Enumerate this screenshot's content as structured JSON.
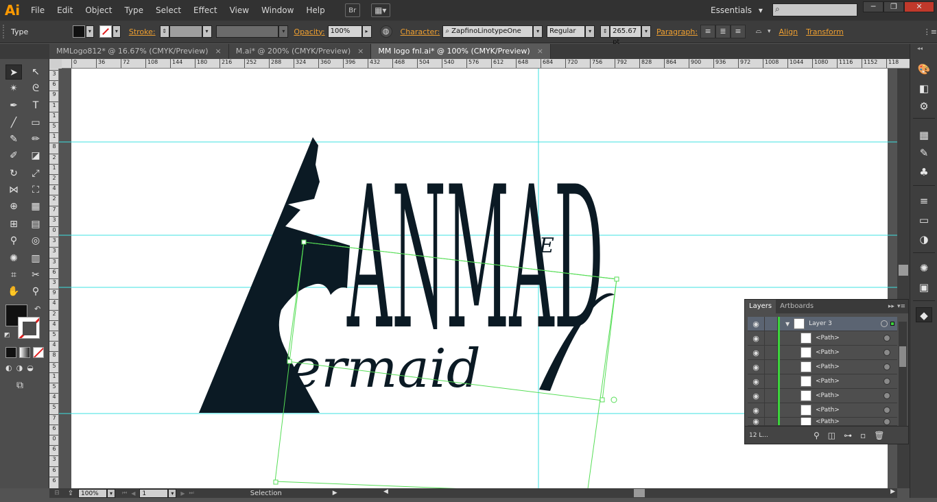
{
  "app": {
    "logo": "Ai"
  },
  "menu": [
    "File",
    "Edit",
    "Object",
    "Type",
    "Select",
    "Effect",
    "View",
    "Window",
    "Help"
  ],
  "menubar": {
    "bridge": "Br",
    "workspace": "Essentials",
    "workspace_arrow": "▾",
    "search_icon": "⌕"
  },
  "window_buttons": {
    "minimize": "─",
    "restore": "❐",
    "close": "✕"
  },
  "control": {
    "mode": "Type",
    "stroke_label": "Stroke:",
    "opacity_label": "Opacity:",
    "opacity_value": "100%",
    "character_label": "Character:",
    "font_name": "ZapfinoLinotypeOne",
    "font_style": "Regular",
    "font_size": "265.67 pt",
    "paragraph_label": "Paragraph:",
    "align_label": "Align",
    "transform_label": "Transform",
    "fill_color": "#111111",
    "accent": "#f0a030"
  },
  "tabs": [
    {
      "label": "MMLogo812* @ 16.67% (CMYK/Preview)",
      "close": "×"
    },
    {
      "label": "M.ai* @ 200% (CMYK/Preview)",
      "close": "×"
    },
    {
      "label": "MM logo fnl.ai* @ 100% (CMYK/Preview)",
      "close": "×"
    }
  ],
  "ruler_h": [
    "0",
    "36",
    "72",
    "108",
    "144",
    "180",
    "216",
    "252",
    "288",
    "324",
    "360",
    "396",
    "432",
    "468",
    "504",
    "540",
    "576",
    "612",
    "648",
    "684",
    "720",
    "756",
    "792",
    "828",
    "864",
    "900",
    "936",
    "972",
    "1008",
    "1044",
    "1080",
    "1116",
    "1152",
    "118"
  ],
  "ruler_v": [
    "3",
    "6",
    "9",
    "1",
    "1",
    "5",
    "1",
    "8",
    "2",
    "1",
    "2",
    "4",
    "2",
    "7",
    "3",
    "0",
    "3",
    "3",
    "3",
    "6",
    "3",
    "9",
    "4",
    "2",
    "4",
    "5",
    "4",
    "8",
    "5",
    "1",
    "5",
    "4",
    "5",
    "7",
    "6",
    "0",
    "6",
    "3",
    "6",
    "6"
  ],
  "artwork": {
    "word_top": "ANMAD",
    "letter_e": "E",
    "word_bottom": "ermaid",
    "color": "#0b1a24"
  },
  "status": {
    "zoom": "100%",
    "page": "1",
    "tool": "Selection",
    "first_page": "⏮",
    "prev_page": "◀",
    "next_page": "▶",
    "last_page": "⏭",
    "menu_arrow": "▶",
    "scroll_left": "◀",
    "scroll_right": "▶"
  },
  "layers_panel": {
    "tab_layers": "Layers",
    "tab_artboards": "Artboards",
    "collapse": "▸▸",
    "menu": "▾≡",
    "layer_name": "Layer 3",
    "rows": [
      "<Path>",
      "<Path>",
      "<Path>",
      "<Path>",
      "<Path>",
      "<Path>",
      "<Path>"
    ],
    "count": "12 L...",
    "eye": "◉"
  }
}
